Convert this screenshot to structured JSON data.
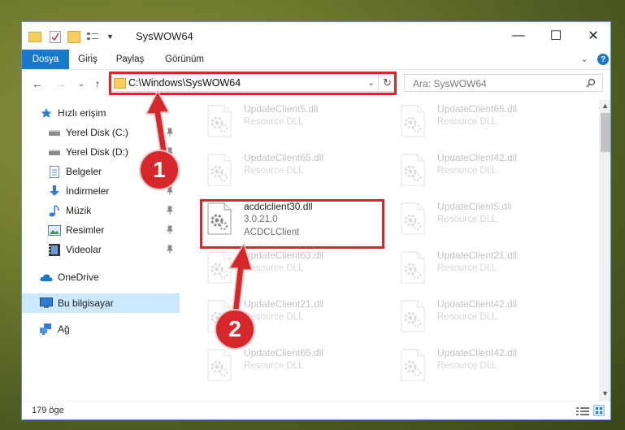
{
  "window": {
    "title": "SysWOW64",
    "controls": {
      "minimize": "—",
      "maximize": "☐",
      "close": "✕"
    }
  },
  "ribbon": {
    "tabs": [
      "Dosya",
      "Giriş",
      "Paylaş",
      "Görünüm"
    ],
    "collapse_glyph": "⌄",
    "help_glyph": "?"
  },
  "navigation": {
    "back": "←",
    "forward": "→",
    "recent": "⌄",
    "up": "↑",
    "address_path": "C:\\Windows\\SysWOW64",
    "address_dropdown": "⌄",
    "refresh": "↻",
    "search_placeholder": "Ara: SysWOW64"
  },
  "sidebar": {
    "items": [
      {
        "label": "Hızlı erişim",
        "icon": "star-icon",
        "pinned": false
      },
      {
        "label": "Yerel Disk (C:)",
        "icon": "drive-icon",
        "pinned": true
      },
      {
        "label": "Yerel Disk (D:)",
        "icon": "drive-icon",
        "pinned": true
      },
      {
        "label": "Belgeler",
        "icon": "documents-icon",
        "pinned": true
      },
      {
        "label": "İndirmeler",
        "icon": "download-icon",
        "pinned": true
      },
      {
        "label": "Müzik",
        "icon": "music-icon",
        "pinned": true
      },
      {
        "label": "Resimler",
        "icon": "pictures-icon",
        "pinned": true
      },
      {
        "label": "Videolar",
        "icon": "videos-icon",
        "pinned": true
      },
      {
        "label": "OneDrive",
        "icon": "cloud-icon",
        "pinned": false
      },
      {
        "label": "Bu bilgisayar",
        "icon": "computer-icon",
        "pinned": false,
        "selected": true
      },
      {
        "label": "Ağ",
        "icon": "network-icon",
        "pinned": false
      }
    ]
  },
  "files": {
    "left_column": [
      {
        "name": "UpdateClient5.dll",
        "desc": "Resource DLL"
      },
      {
        "name": "UpdateClient65.dll",
        "desc": "Resource DLL"
      },
      {
        "name": "acdclclient30.dll",
        "desc": "3.0.21.0",
        "desc2": "ACDCLClient",
        "highlighted": true
      },
      {
        "name": "UpdateClient63.dll",
        "desc": "Resource DLL"
      },
      {
        "name": "UpdateClient21.dll",
        "desc": "Resource DLL"
      },
      {
        "name": "UpdateClient65.dll",
        "desc": "Resource DLL"
      }
    ],
    "right_column": [
      {
        "name": "UpdateClient65.dll",
        "desc": "Resource DLL"
      },
      {
        "name": "UpdateClient42.dll",
        "desc": "Resource DLL"
      },
      {
        "name": "UpdateClient5.dll",
        "desc": "Resource DLL"
      },
      {
        "name": "UpdateClient21.dll",
        "desc": "Resource DLL"
      },
      {
        "name": "UpdateClient42.dll",
        "desc": "Resource DLL"
      },
      {
        "name": "UpdateClient42.dll",
        "desc": "Resource DLL"
      }
    ]
  },
  "status_bar": {
    "item_count": "179 öge"
  },
  "annotations": {
    "step1": "1",
    "step2": "2",
    "color": "#d6282b"
  }
}
